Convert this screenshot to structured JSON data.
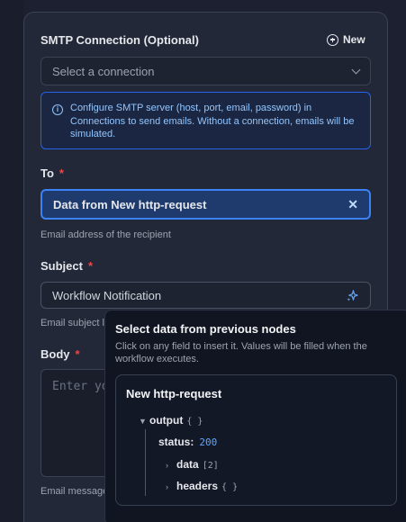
{
  "smtp": {
    "label": "SMTP Connection (Optional)",
    "new_label": "New",
    "select_placeholder": "Select a connection",
    "info_text": "Configure SMTP server (host, port, email, password) in Connections to send emails. Without a connection, emails will be simulated."
  },
  "to": {
    "label": "To",
    "required": "*",
    "value": "Data from New http-request",
    "helper": "Email address of the recipient"
  },
  "subject": {
    "label": "Subject",
    "required": "*",
    "value": "Workflow Notification",
    "helper": "Email subject l"
  },
  "body": {
    "label": "Body",
    "required": "*",
    "placeholder": "Enter yo",
    "helper": "Email message"
  },
  "popover": {
    "title": "Select data from previous nodes",
    "description": "Click on any field to insert it. Values will be filled when the workflow executes.",
    "node_title": "New http-request",
    "tree": {
      "output_key": "output",
      "output_type": "{ }",
      "status_key": "status:",
      "status_value": "200",
      "data_key": "data",
      "data_type": "[2]",
      "headers_key": "headers",
      "headers_type": "{ }"
    }
  },
  "colors": {
    "accent": "#3b82f6",
    "required": "#ef4444",
    "info_text": "#93c5fd",
    "value_number": "#60a5fa"
  }
}
